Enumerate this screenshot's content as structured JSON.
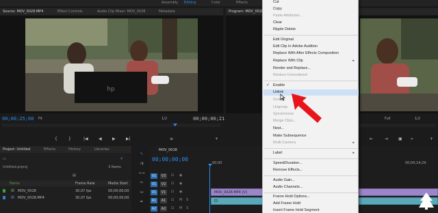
{
  "workspace": {
    "tabs": [
      "Assembly",
      "Editing",
      "Color",
      "Effects"
    ],
    "active": "Editing"
  },
  "source": {
    "tabs": [
      "Source: MOV_0028.MP4",
      "Effect Controls",
      "Audio Clip Mixer: MOV_0028",
      "Metadata"
    ],
    "timecode_in": "00;00;25;00",
    "fit": "Fit",
    "scale": "1/2",
    "timecode_out": "00;00;06;21"
  },
  "program": {
    "tab": "Program: MOV_0028",
    "fit": "Full",
    "scale": "1/2"
  },
  "transport": {
    "buttons": [
      "{",
      "}",
      "|◀",
      "◀",
      "▶",
      "▶|",
      "≡",
      "+"
    ]
  },
  "project": {
    "tabs": [
      "Project: Untitled",
      "Effects",
      "History",
      "Libraries"
    ],
    "file": "Untitled.prproj",
    "items_count": "3 Items",
    "columns": [
      "Name",
      "Frame Rate",
      "Media Start"
    ],
    "rows": [
      {
        "name": "MOV_0028",
        "rate": "30,07 fps",
        "start": "00;00;00;00",
        "color": "#3aa03a"
      },
      {
        "name": "MOV_0028.MP4",
        "rate": "30,07 fps",
        "start": "00;00;00;00",
        "color": "#3a7cc8"
      }
    ]
  },
  "timeline": {
    "tab": "MOV_0028",
    "timecode": "00;00;00;00",
    "ruler_left": "00;00",
    "ruler_right": "00;00;14;29",
    "tracks": [
      "V3",
      "V2",
      "V1",
      "A1",
      "A2"
    ],
    "track_targets": [
      "V1",
      "V1",
      "V1",
      "A1",
      "A2"
    ],
    "clip_label": "MOV_0028.MP4 [V]"
  },
  "context_menu": {
    "items": [
      {
        "label": "Cut",
        "disabled": false
      },
      {
        "label": "Copy",
        "disabled": false
      },
      {
        "label": "Paste Attributes...",
        "disabled": true
      },
      {
        "label": "Clear",
        "disabled": false
      },
      {
        "label": "Ripple Delete",
        "disabled": false
      },
      {
        "label": "Edit Original",
        "disabled": false
      },
      {
        "label": "Edit Clip In Adobe Audition",
        "disabled": false
      },
      {
        "label": "Replace With After Effects Composition",
        "disabled": false
      },
      {
        "label": "Replace With Clip",
        "disabled": false,
        "submenu": true
      },
      {
        "label": "Render and Replace...",
        "disabled": false
      },
      {
        "label": "Restore Unrendered",
        "disabled": true
      },
      {
        "label": "Enable",
        "disabled": false,
        "checked": true
      },
      {
        "label": "Unlink",
        "disabled": false,
        "highlighted": true
      },
      {
        "label": "Group",
        "disabled": true
      },
      {
        "label": "Ungroup",
        "disabled": true
      },
      {
        "label": "Synchronize",
        "disabled": true
      },
      {
        "label": "Merge Clips...",
        "disabled": true
      },
      {
        "label": "Nest...",
        "disabled": false
      },
      {
        "label": "Make Subsequence",
        "disabled": false
      },
      {
        "label": "Multi-Camera",
        "disabled": true,
        "submenu": true
      },
      {
        "label": "Label",
        "disabled": false,
        "submenu": true
      },
      {
        "label": "Speed/Duration...",
        "disabled": false
      },
      {
        "label": "Remove Effects...",
        "disabled": false
      },
      {
        "label": "Audio Gain...",
        "disabled": false
      },
      {
        "label": "Audio Channels...",
        "disabled": false
      },
      {
        "label": "Frame Hold Options...",
        "disabled": false
      },
      {
        "label": "Add Frame Hold",
        "disabled": false
      },
      {
        "label": "Insert Frame Hold Segment",
        "disabled": false
      }
    ]
  },
  "colors": {
    "accent": "#2d8ceb",
    "arrow": "#e8141c",
    "highlight": "#cde0f5"
  }
}
